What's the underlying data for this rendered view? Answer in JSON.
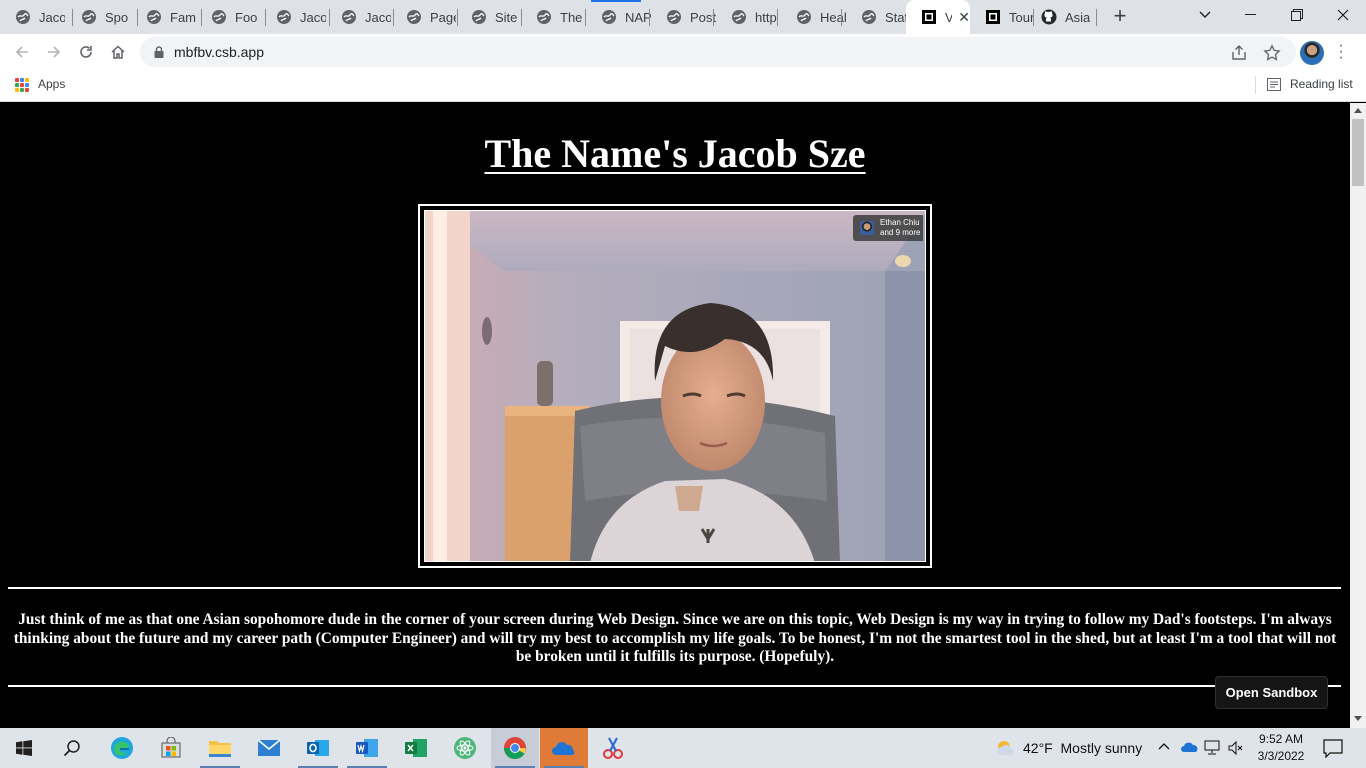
{
  "browser": {
    "tabs": [
      {
        "label": "Jaco",
        "favicon": "globe-icon"
      },
      {
        "label": "Spo",
        "favicon": "globe-icon"
      },
      {
        "label": "Fam",
        "favicon": "globe-icon"
      },
      {
        "label": "Foo",
        "favicon": "globe-icon"
      },
      {
        "label": "Jaco",
        "favicon": "globe-icon"
      },
      {
        "label": "Jaco",
        "favicon": "globe-icon"
      },
      {
        "label": "Page",
        "favicon": "globe-icon"
      },
      {
        "label": "Site",
        "favicon": "globe-icon"
      },
      {
        "label": "The",
        "favicon": "globe-icon"
      },
      {
        "label": "NAP",
        "favicon": "globe-icon"
      },
      {
        "label": "Post",
        "favicon": "globe-icon"
      },
      {
        "label": "http",
        "favicon": "globe-icon"
      },
      {
        "label": "Heal",
        "favicon": "globe-icon"
      },
      {
        "label": "State",
        "favicon": "globe-icon"
      },
      {
        "label": "V",
        "favicon": "codesandbox-icon",
        "active": true
      },
      {
        "label": "Tour",
        "favicon": "codesandbox-icon"
      },
      {
        "label": "Asia",
        "favicon": "github-icon"
      }
    ],
    "url": "mbfbv.csb.app",
    "bookmarks": {
      "apps_label": "Apps",
      "reading_list_label": "Reading list"
    },
    "accent_color": "#1a73e8"
  },
  "page": {
    "title": "The Name's Jacob Sze",
    "photo_overlay": {
      "line1": "Ethan Chiu",
      "line2": "and 9 more"
    },
    "bio": "Just think of me as that one Asian sopohomore dude in the corner of your screen during Web Design. Since we are on this topic, Web Design is my way in trying to follow my Dad's footsteps. I'm always thinking about the future and my career path (Computer Engineer) and will try my best to accomplish my life goals. To be honest, I'm not the smartest tool in the shed, but at least I'm a tool that will not be broken until it fulfills its purpose. (Hopefuly).",
    "open_sandbox_label": "Open Sandbox",
    "background_color": "#000000",
    "text_color": "#ffffff"
  },
  "taskbar": {
    "apps": [
      {
        "name": "start",
        "icon": "windows-icon"
      },
      {
        "name": "search",
        "icon": "search-icon"
      },
      {
        "name": "edge",
        "icon": "edge-icon"
      },
      {
        "name": "store",
        "icon": "store-icon"
      },
      {
        "name": "file-explorer",
        "icon": "folder-icon"
      },
      {
        "name": "mail",
        "icon": "mail-icon"
      },
      {
        "name": "outlook",
        "icon": "outlook-icon"
      },
      {
        "name": "word",
        "icon": "word-icon"
      },
      {
        "name": "excel",
        "icon": "excel-icon"
      },
      {
        "name": "atom",
        "icon": "atom-icon"
      },
      {
        "name": "chrome",
        "icon": "chrome-icon",
        "active": true
      },
      {
        "name": "onedrive",
        "icon": "onedrive-icon",
        "highlight": true
      },
      {
        "name": "snip",
        "icon": "snip-icon"
      }
    ],
    "weather": {
      "temp": "42°F",
      "condition": "Mostly sunny"
    },
    "clock": {
      "time": "9:52 AM",
      "date": "3/3/2022"
    }
  }
}
